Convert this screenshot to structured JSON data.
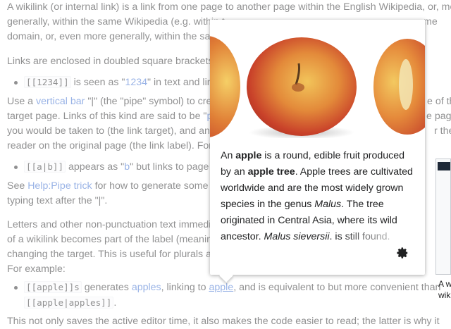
{
  "article": {
    "p1_line1": "A wikilink (or internal link) is a link from one page to another page within the English Wikipedia, or, more",
    "p1_line2": "generally, within the same Wikipedia (e.g. within t",
    "p1_line2_tail": "me",
    "p1_line3": "domain, or, even more generally, within the same",
    "p2": "Links are enclosed in doubled square brackets:",
    "b1_code": "[[1234]]",
    "b1_mid": " is seen as \"",
    "b1_link": "1234",
    "b1_tail": "\" in text and links",
    "p3_a": "Use a ",
    "p3_link": "vertical bar",
    "p3_b": " \"|\" (the \"pipe\" symbol) to create",
    "p3_tail1": "e of the",
    "p3_line2_a": "target page. Links of this kind are said to be \"",
    "p3_line2_link": "pipe",
    "p3_tail2": "e page",
    "p3_line3": "you would be taken to (the link target), and anyth",
    "p3_tail3": "r the",
    "p3_line4": "reader on the original page (the link label). For ex",
    "b2_code": "[[a|b]]",
    "b2_mid": " appears as \"",
    "b2_link1": "b",
    "b2_tail": "\" but links to page \"",
    "b2_link2": "a",
    "p4_a": "See ",
    "p4_link": "Help:Pipe trick",
    "p4_b": " for how to generate some co",
    "p4_line2": "typing text after the \"|\".",
    "p5_line1": "Letters and other non-punctuation text immediate",
    "p5_line2": "of a wikilink becomes part of the label (meaning i",
    "p5_line3": "changing the target. This is useful for plurals and",
    "p5_line4": "For example:",
    "b3_code": "[[apple]]s",
    "b3_a": " generates ",
    "b3_link1": "apples",
    "b3_b": ", linking to ",
    "b3_link2": "apple",
    "b3_c": ", and is equivalent to but more convenient than",
    "b3_code2": "[[apple|apples]]",
    "b3_end": ".",
    "p6": "This not only saves the active editor time, it also makes the code easier to read; the latter is why it"
  },
  "popup": {
    "t1": "An ",
    "b1": "apple",
    "t2": " is a round, edible fruit produced by an ",
    "b2": "apple tree",
    "t3": ". Apple trees are cultivated worldwide and are the most widely grown species in the genus ",
    "i1": "Malus",
    "t4": ". The tree originated in Central Asia, where its wild ancestor, ",
    "i2": "Malus sieversii",
    "t5": ", is still found. Apples have been grown for thousands of years"
  },
  "thumbnail": {
    "caption_line1": "A w",
    "caption_line2": "wik"
  },
  "icons": {
    "settings": "gear-icon"
  },
  "colors": {
    "link": "#3366cc",
    "text": "#202122"
  }
}
